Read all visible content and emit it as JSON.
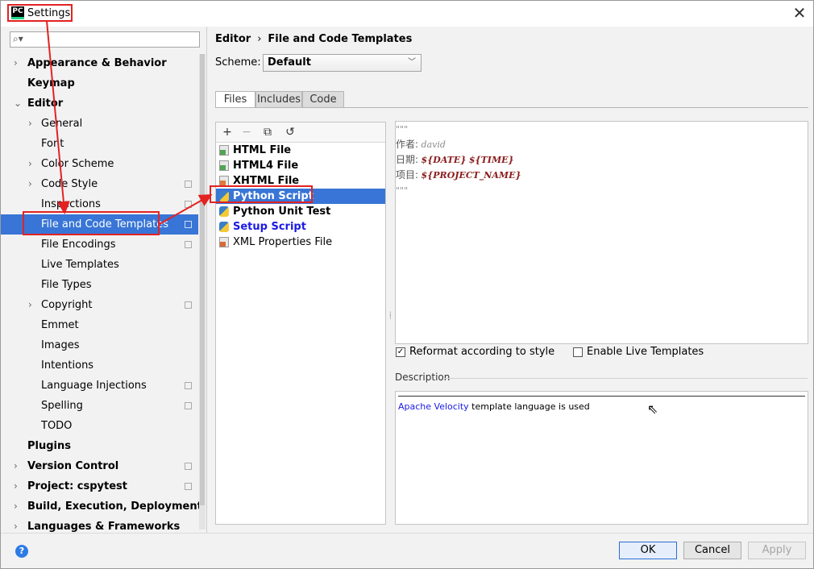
{
  "window": {
    "title": "Settings",
    "app_icon": "PC",
    "close": "✕"
  },
  "search": {
    "placeholder": ""
  },
  "tree": [
    {
      "label": "Appearance & Behavior",
      "level": 0,
      "bold": true,
      "arrow": "›"
    },
    {
      "label": "Keymap",
      "level": 0,
      "bold": true,
      "arrow": ""
    },
    {
      "label": "Editor",
      "level": 0,
      "bold": true,
      "arrow": "⌄"
    },
    {
      "label": "General",
      "level": 1,
      "bold": false,
      "arrow": "›"
    },
    {
      "label": "Font",
      "level": 1,
      "bold": false,
      "arrow": ""
    },
    {
      "label": "Color Scheme",
      "level": 1,
      "bold": false,
      "arrow": "›"
    },
    {
      "label": "Code Style",
      "level": 1,
      "bold": false,
      "arrow": "›",
      "cfg": true
    },
    {
      "label": "Inspections",
      "level": 1,
      "bold": false,
      "arrow": "",
      "cfg": true
    },
    {
      "label": "File and Code Templates",
      "level": 1,
      "bold": false,
      "arrow": "",
      "cfg": true,
      "selected": true
    },
    {
      "label": "File Encodings",
      "level": 1,
      "bold": false,
      "arrow": "",
      "cfg": true
    },
    {
      "label": "Live Templates",
      "level": 1,
      "bold": false,
      "arrow": ""
    },
    {
      "label": "File Types",
      "level": 1,
      "bold": false,
      "arrow": ""
    },
    {
      "label": "Copyright",
      "level": 1,
      "bold": false,
      "arrow": "›",
      "cfg": true
    },
    {
      "label": "Emmet",
      "level": 1,
      "bold": false,
      "arrow": ""
    },
    {
      "label": "Images",
      "level": 1,
      "bold": false,
      "arrow": ""
    },
    {
      "label": "Intentions",
      "level": 1,
      "bold": false,
      "arrow": ""
    },
    {
      "label": "Language Injections",
      "level": 1,
      "bold": false,
      "arrow": "",
      "cfg": true
    },
    {
      "label": "Spelling",
      "level": 1,
      "bold": false,
      "arrow": "",
      "cfg": true
    },
    {
      "label": "TODO",
      "level": 1,
      "bold": false,
      "arrow": ""
    },
    {
      "label": "Plugins",
      "level": 0,
      "bold": true,
      "arrow": ""
    },
    {
      "label": "Version Control",
      "level": 0,
      "bold": true,
      "arrow": "›",
      "cfg": true
    },
    {
      "label": "Project: cspytest",
      "level": 0,
      "bold": true,
      "arrow": "›",
      "cfg": true
    },
    {
      "label": "Build, Execution, Deployment",
      "level": 0,
      "bold": true,
      "arrow": "›"
    },
    {
      "label": "Languages & Frameworks",
      "level": 0,
      "bold": true,
      "arrow": "›"
    }
  ],
  "breadcrumb": {
    "parent": "Editor",
    "sep": "›",
    "current": "File and Code Templates"
  },
  "scheme": {
    "label": "Scheme:",
    "value": "Default"
  },
  "tabs": [
    "Files",
    "Includes",
    "Code"
  ],
  "toolbar": {
    "add": "+",
    "remove": "−",
    "copy": "⧉",
    "reset": "↺"
  },
  "files": [
    {
      "label": "HTML File",
      "icon": "html-file-icon",
      "bold": true
    },
    {
      "label": "HTML4 File",
      "icon": "html-file-icon",
      "bold": true
    },
    {
      "label": "XHTML File",
      "icon": "xhtml-file-icon",
      "bold": true
    },
    {
      "label": "Python Script",
      "icon": "python-file-icon",
      "bold": true,
      "selected": true
    },
    {
      "label": "Python Unit Test",
      "icon": "python-file-icon",
      "bold": true
    },
    {
      "label": "Setup Script",
      "icon": "python-file-icon",
      "bold": true,
      "blue": true
    },
    {
      "label": "XML Properties File",
      "icon": "xml-file-icon",
      "bold": false
    }
  ],
  "editor": {
    "line1": "\"\"\"",
    "author_key": "作者:",
    "author_val": "david",
    "date_key": "日期:",
    "date_var1": "${DATE}",
    "date_var2": "${TIME}",
    "project_key": "项目:",
    "project_var": "${PROJECT_NAME}",
    "line5": "\"\"\""
  },
  "options": {
    "reformat": "Reformat according to style",
    "reformat_checked": true,
    "live": "Enable Live Templates",
    "live_checked": false
  },
  "description": {
    "label": "Description",
    "link": "Apache Velocity",
    "text": " template language is used"
  },
  "buttons": {
    "ok": "OK",
    "cancel": "Cancel",
    "apply": "Apply"
  },
  "help": "?",
  "colors": {
    "selection": "#3875d6",
    "annotation": "#e32222",
    "link": "#1a1ae6"
  }
}
